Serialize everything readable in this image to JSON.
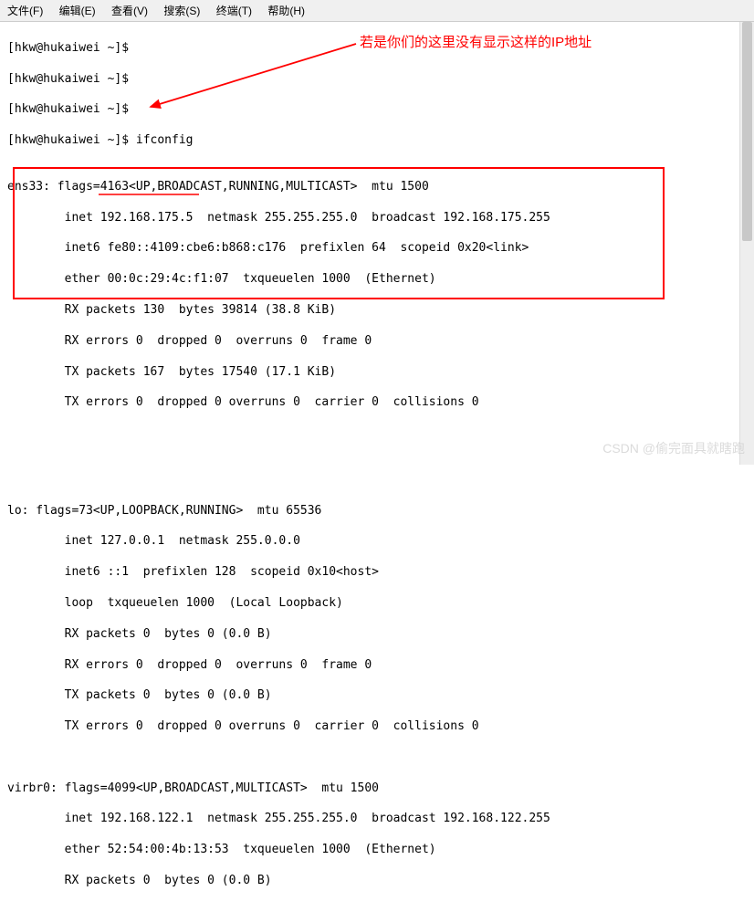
{
  "menu": {
    "file": "文件(F)",
    "edit": "编辑(E)",
    "view": "查看(V)",
    "search": "搜索(S)",
    "terminal": "终端(T)",
    "help": "帮助(H)"
  },
  "prompt": {
    "line1": "[hkw@hukaiwei ~]$ ",
    "line2": "[hkw@hukaiwei ~]$ ",
    "line3": "[hkw@hukaiwei ~]$ ",
    "line4_full": "[hkw@hukaiwei ~]$ ifconfig"
  },
  "annotation": {
    "text": "若是你们的这里没有显示这样的IP地址"
  },
  "ifconfig": {
    "ens33": {
      "l1": "ens33: flags=4163<UP,BROADCAST,RUNNING,MULTICAST>  mtu 1500",
      "l2": "        inet 192.168.175.5  netmask 255.255.255.0  broadcast 192.168.175.255",
      "l3": "        inet6 fe80::4109:cbe6:b868:c176  prefixlen 64  scopeid 0x20<link>",
      "l4": "        ether 00:0c:29:4c:f1:07  txqueuelen 1000  (Ethernet)",
      "l5": "        RX packets 130  bytes 39814 (38.8 KiB)",
      "l6": "        RX errors 0  dropped 0  overruns 0  frame 0",
      "l7": "        TX packets 167  bytes 17540 (17.1 KiB)",
      "l8": "        TX errors 0  dropped 0 overruns 0  carrier 0  collisions 0"
    },
    "lo": {
      "l1": "lo: flags=73<UP,LOOPBACK,RUNNING>  mtu 65536",
      "l2": "        inet 127.0.0.1  netmask 255.0.0.0",
      "l3": "        inet6 ::1  prefixlen 128  scopeid 0x10<host>",
      "l4": "        loop  txqueuelen 1000  (Local Loopback)",
      "l5": "        RX packets 0  bytes 0 (0.0 B)",
      "l6": "        RX errors 0  dropped 0  overruns 0  frame 0",
      "l7": "        TX packets 0  bytes 0 (0.0 B)",
      "l8": "        TX errors 0  dropped 0 overruns 0  carrier 0  collisions 0"
    },
    "virbr0": {
      "l1": "virbr0: flags=4099<UP,BROADCAST,MULTICAST>  mtu 1500",
      "l2": "        inet 192.168.122.1  netmask 255.255.255.0  broadcast 192.168.122.255",
      "l3": "        ether 52:54:00:4b:13:53  txqueuelen 1000  (Ethernet)",
      "l4": "        RX packets 0  bytes 0 (0.0 B)"
    }
  },
  "watermark": "CSDN @偷完面具就瞎跑"
}
